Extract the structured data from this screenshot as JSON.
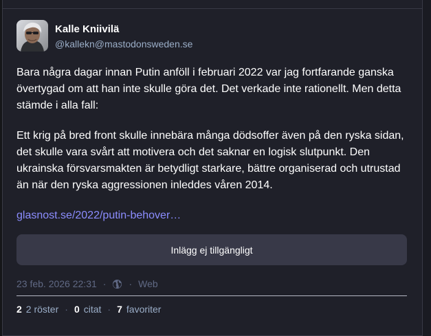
{
  "author": {
    "display_name": "Kalle Kniivilä",
    "handle": "@kallekn@mastodonsweden.se"
  },
  "content": {
    "paragraphs": [
      "Bara några dagar innan Putin anföll i februari 2022 var jag fortfarande ganska övertygad om att han inte skulle göra det. Det verkade inte rationellt. Men detta stämde i alla fall:",
      "Ett krig på bred front skulle innebära många dödsoffer även på den ryska sidan, det skulle vara svårt att motivera och det saknar en logisk slutpunkt. Den ukrainska försvarsmakten är betydligt starkare, bättre organiserad och utrustad än när den ryska aggressionen inleddes våren 2014."
    ],
    "link_text": "glasnost.se/2022/putin-behover…"
  },
  "quote_unavailable": "Inlägg ej tillgängligt",
  "meta": {
    "timestamp": "23 feb. 2026 22:31",
    "visibility_icon": "globe-icon",
    "separator": "·",
    "app": "Web"
  },
  "stats": {
    "boosts_count": "2",
    "boosts_label": "2 röster",
    "quotes_count": "0",
    "quotes_label": "citat",
    "favourites_count": "7",
    "favourites_label": "favoriter",
    "separator": "·"
  },
  "colors": {
    "background": "#1f2029",
    "link": "#8c8dff",
    "muted": "#606984",
    "handle": "#9baec8",
    "button_bg": "#383948"
  }
}
